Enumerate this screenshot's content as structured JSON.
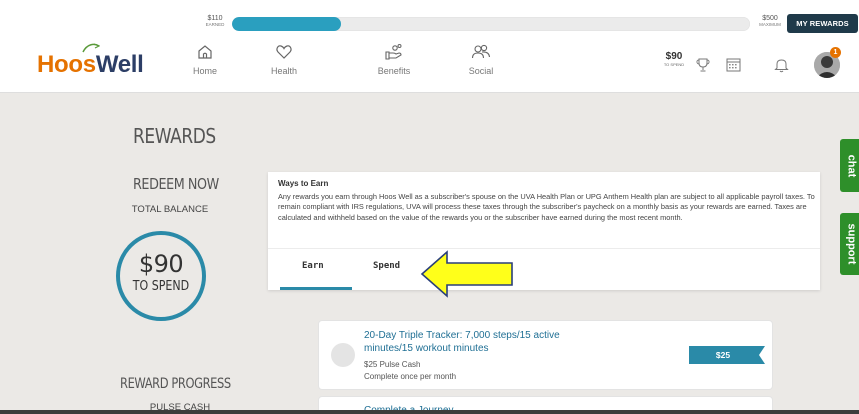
{
  "progress": {
    "earned_amount": "$110",
    "earned_label": "EARNED",
    "fill_fraction": 0.21,
    "maximum_amount": "$500",
    "maximum_label": "MAXIMUM",
    "my_rewards_label": "MY REWARDS",
    "fill_color": "#2a9fbf"
  },
  "brand": {
    "logo_part1": "Hoos",
    "logo_part2": "Well",
    "color_orange": "#e57200",
    "color_navy": "#2c3e66"
  },
  "nav": [
    {
      "label": "Home",
      "icon": "home-icon"
    },
    {
      "label": "Health",
      "icon": "heart-icon"
    },
    {
      "label": "Benefits",
      "icon": "benefits-hand-icon"
    },
    {
      "label": "Social",
      "icon": "people-icon"
    }
  ],
  "header_right": {
    "spend_amount": "$90",
    "spend_label": "TO SPEND",
    "icons": [
      "trophy-icon",
      "calendar-icon",
      "bell-icon",
      "avatar"
    ],
    "notification_count": "1"
  },
  "left_panel": {
    "title": "REWARDS",
    "redeem_title": "REDEEM NOW",
    "total_balance_label": "TOTAL BALANCE",
    "balance_amount": "$90",
    "balance_sub": "TO SPEND",
    "reward_progress_title": "REWARD PROGRESS",
    "pulse_cash_label": "PULSE CASH"
  },
  "ways": {
    "title": "Ways to Earn",
    "body": "Any rewards you earn through Hoos Well as a subscriber's spouse on the UVA Health Plan or UPG Anthem Health plan are subject to all applicable payroll taxes. To remain compliant with IRS regulations, UVA will process these taxes through the subscriber's paycheck on a monthly basis as your rewards are earned. Taxes are calculated and withheld based on the value of the rewards you or the subscriber have earned during the most recent month."
  },
  "tabs": {
    "earn": "Earn",
    "spend": "Spend",
    "active": "Earn",
    "accent": "#2a8aa8"
  },
  "activities": [
    {
      "title": "20-Day Triple Tracker: 7,000 steps/15 active minutes/15 workout minutes",
      "reward": "$25 Pulse Cash",
      "frequency": "Complete once per month",
      "flag_value": "$25"
    },
    {
      "title": "Complete a Journey"
    }
  ],
  "side_tabs": {
    "chat": "chat",
    "support": "support",
    "color": "#2e8f2a"
  }
}
